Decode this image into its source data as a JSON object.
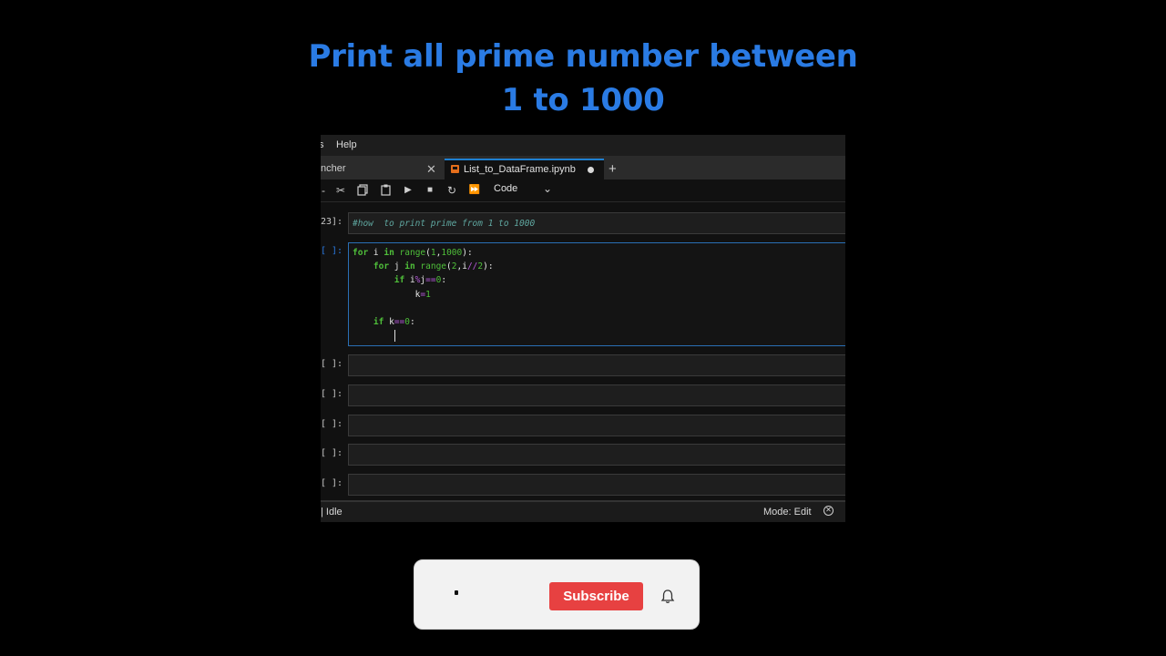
{
  "headline": {
    "line1": "Print all prime number between",
    "line2": "1 to 1000"
  },
  "menubar": {
    "partial_item": "s",
    "help_label": "Help"
  },
  "tabs": [
    {
      "label": "ncher",
      "active": false
    },
    {
      "label": "List_to_DataFrame.ipynb",
      "active": true,
      "unsaved": true
    }
  ],
  "toolbar": {
    "cell_type": "Code",
    "icons": [
      "cut-icon",
      "copy-icon",
      "paste-icon",
      "run-icon",
      "stop-icon",
      "restart-icon",
      "fast-forward-icon"
    ]
  },
  "cells": [
    {
      "prompt": "23]:",
      "code_comment": "#how  to print prime from 1 to 1000"
    },
    {
      "prompt": "[ ]:",
      "active": true
    },
    {
      "prompt": "[ ]:"
    },
    {
      "prompt": "[ ]:"
    },
    {
      "prompt": "[ ]:"
    },
    {
      "prompt": "[ ]:"
    },
    {
      "prompt": "[ ]:"
    }
  ],
  "code_lines": [
    "for i in range(1,1000):",
    "    for j in range(2,i//2):",
    "        if i%j==0:",
    "            k=1",
    "",
    "    if k==0:",
    "        "
  ],
  "statusbar": {
    "kernel_status": "| Idle",
    "mode": "Mode: Edit"
  },
  "subscribe": {
    "button_label": "Subscribe",
    "button_color": "#e74141"
  },
  "colors": {
    "headline": "#2a7be4",
    "keyword": "#4fbf3a",
    "operator": "#b45ad8",
    "comment": "#5fa7a0",
    "active_border": "#2a6fb5"
  }
}
